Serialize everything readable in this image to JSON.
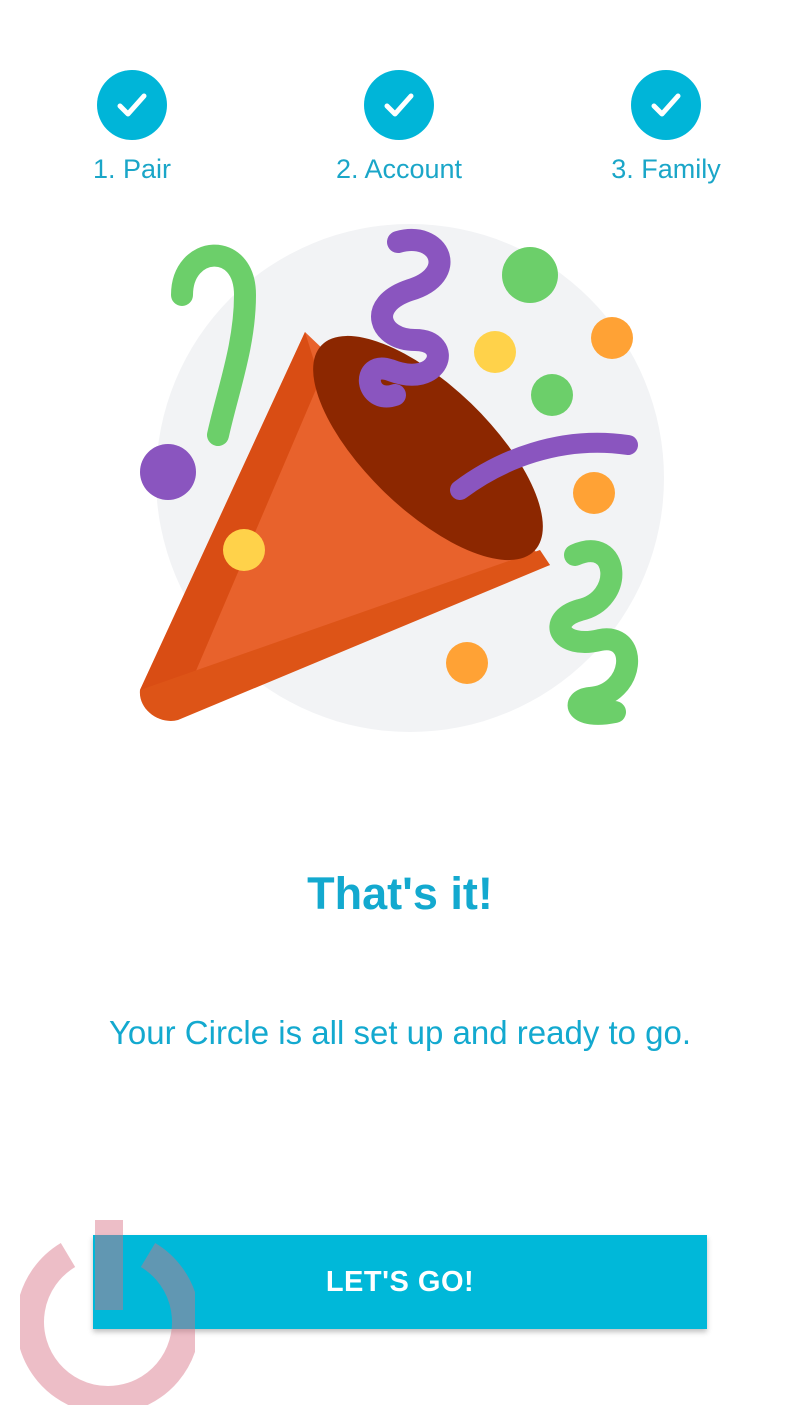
{
  "steps": [
    {
      "label": "1. Pair",
      "done": true
    },
    {
      "label": "2. Account",
      "done": true
    },
    {
      "label": "3. Family",
      "done": true
    }
  ],
  "hero": {
    "illustration": "party-popper-icon"
  },
  "main": {
    "title": "That's it!",
    "subtitle": "Your Circle is all set up and ready to go."
  },
  "cta": {
    "label": "LET'S GO!"
  },
  "colors": {
    "accent": "#00b8d9",
    "text_accent": "#13a9cf",
    "popper": "#e55f2c",
    "confetti_green": "#6ccf6a",
    "confetti_purple": "#8a55bf",
    "confetti_orange": "#ffa235",
    "confetti_yellow": "#ffd24a"
  },
  "watermark": {
    "icon": "power-logo-watermark"
  }
}
